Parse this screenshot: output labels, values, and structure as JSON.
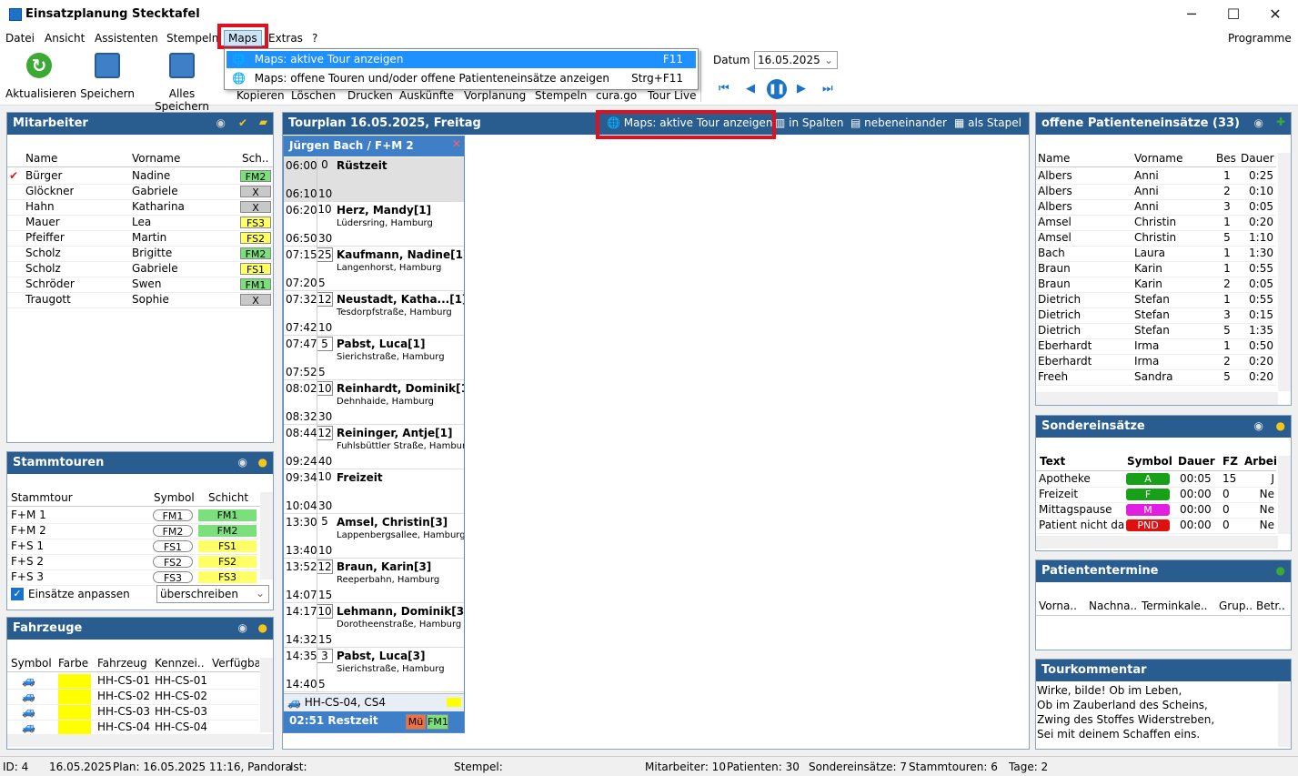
{
  "window": {
    "title": "Einsatzplanung Stecktafel",
    "min": "─",
    "max": "☐",
    "close": "✕"
  },
  "menu": {
    "items": [
      "Datei",
      "Ansicht",
      "Assistenten",
      "Stempeln",
      "Maps",
      "Extras",
      "?"
    ],
    "right": "Programme"
  },
  "toolbar": {
    "refresh": "Aktualisieren",
    "save": "Speichern",
    "save_all": "Alles Speichern",
    "hidden": [
      "Kopieren",
      "Löschen",
      "Drucken",
      "Auskünfte",
      "Vorplanung",
      "Stempeln",
      "cura.go",
      "Tour Live"
    ],
    "date_label": "Datum",
    "date_value": "16.05.2025"
  },
  "dropdown": {
    "items": [
      {
        "label": "Maps: aktive Tour anzeigen",
        "shortcut": "F11"
      },
      {
        "label": "Maps: offene Touren und/oder offene Patienteneinsätze anzeigen",
        "shortcut": "Strg+F11"
      }
    ]
  },
  "mitarbeiter": {
    "title": "Mitarbeiter",
    "cols": [
      "Name",
      "Vorname",
      "Sch.."
    ],
    "rows": [
      [
        "Bürger",
        "Nadine",
        "FM2",
        "green"
      ],
      [
        "Glöckner",
        "Gabriele",
        "X",
        "gray"
      ],
      [
        "Hahn",
        "Katharina",
        "X",
        "gray"
      ],
      [
        "Mauer",
        "Lea",
        "FS3",
        "yellow"
      ],
      [
        "Pfeiffer",
        "Martin",
        "FS2",
        "yellow"
      ],
      [
        "Scholz",
        "Brigitte",
        "FM2",
        "green"
      ],
      [
        "Scholz",
        "Gabriele",
        "FS1",
        "yellow"
      ],
      [
        "Schröder",
        "Swen",
        "FM1",
        "green"
      ],
      [
        "Traugott",
        "Sophie",
        "X",
        "gray"
      ]
    ]
  },
  "stammtouren": {
    "title": "Stammtouren",
    "cols": [
      "Stammtour",
      "Symbol",
      "Schicht"
    ],
    "rows": [
      [
        "F+M 1",
        "FM1",
        "FM1",
        "green"
      ],
      [
        "F+M 2",
        "FM2",
        "FM2",
        "green"
      ],
      [
        "F+S 1",
        "FS1",
        "FS1",
        "yellow"
      ],
      [
        "F+S 2",
        "FS2",
        "FS2",
        "yellow"
      ],
      [
        "F+S 3",
        "FS3",
        "FS3",
        "yellow"
      ]
    ],
    "checkbox": "Einsätze anpassen",
    "select": "überschreiben"
  },
  "fahrzeuge": {
    "title": "Fahrzeuge",
    "cols": [
      "Symbol",
      "Farbe",
      "Fahrzeug",
      "Kennzei..",
      "Verfügba"
    ],
    "rows": [
      [
        "HH-CS-01",
        "HH-CS-01"
      ],
      [
        "HH-CS-02",
        "HH-CS-02"
      ],
      [
        "HH-CS-03",
        "HH-CS-03"
      ],
      [
        "HH-CS-04",
        "HH-CS-04"
      ]
    ]
  },
  "tourplan": {
    "title": "Tourplan 16.05.2025, Freitag",
    "maps_btn": "Maps: aktive Tour anzeigen",
    "spalten": "in Spalten",
    "neben": "nebeneinander",
    "stapel": "als Stapel",
    "tour_header": "Jürgen Bach / F+M 2",
    "entries": [
      {
        "t1": "06:00",
        "n": "0",
        "name": "Rüstzeit",
        "addr": "",
        "t2": "06:10",
        "d2": "10",
        "gray": true
      },
      {
        "t1": "06:20",
        "n": "10",
        "name": "Herz, Mandy[1]",
        "addr": "Lüdersring, Hamburg",
        "t2": "06:50",
        "d2": "30"
      },
      {
        "t1": "07:15",
        "n": "25",
        "name": "Kaufmann, Nadine[1]",
        "addr": "Langenhorst, Hamburg",
        "t2": "07:20",
        "d2": "5",
        "box": true
      },
      {
        "t1": "07:32",
        "n": "12",
        "name": "Neustadt, Katha...[1]",
        "addr": "Tesdorpfstraße, Hamburg",
        "t2": "07:42",
        "d2": "10",
        "box": true
      },
      {
        "t1": "07:47",
        "n": "5",
        "name": "Pabst, Luca[1]",
        "addr": "Sierichstraße, Hamburg",
        "t2": "07:52",
        "d2": "5",
        "box": true
      },
      {
        "t1": "08:02",
        "n": "10",
        "name": "Reinhardt, Dominik[1]",
        "addr": "Dehnhaide, Hamburg",
        "t2": "08:32",
        "d2": "30",
        "box": true
      },
      {
        "t1": "08:44",
        "n": "12",
        "name": "Reininger, Antje[1]",
        "addr": "Fuhlsbüttler Straße, Hamburg",
        "t2": "09:24",
        "d2": "40",
        "box": true
      },
      {
        "t1": "09:34",
        "n": "10",
        "name": "Freizeit",
        "addr": "",
        "t2": "10:04",
        "d2": "30"
      },
      {
        "t1": "13:30",
        "n": "5",
        "name": "Amsel, Christin[3]",
        "addr": "Lappenbergsallee, Hamburg",
        "t2": "13:40",
        "d2": "10"
      },
      {
        "t1": "13:52",
        "n": "12",
        "name": "Braun, Karin[3]",
        "addr": "Reeperbahn, Hamburg",
        "t2": "14:07",
        "d2": "15",
        "box": true
      },
      {
        "t1": "14:17",
        "n": "10",
        "name": "Lehmann, Dominik[3]",
        "addr": "Dorotheenstraße, Hamburg",
        "t2": "14:32",
        "d2": "15",
        "box": true
      },
      {
        "t1": "14:35",
        "n": "3",
        "name": "Pabst, Luca[3]",
        "addr": "Sierichstraße, Hamburg",
        "t2": "14:40",
        "d2": "5",
        "box": true
      }
    ],
    "vehicle": "HH-CS-04, CS4",
    "rest": "02:51 Restzeit",
    "rest_tag1": "Mü",
    "rest_tag2": "FM1"
  },
  "offene": {
    "title": "offene Patienteneinsätze (33)",
    "cols": [
      "Name",
      "Vorname",
      "Bes",
      "Dauer"
    ],
    "rows": [
      [
        "Albers",
        "Anni",
        "1",
        "0:25"
      ],
      [
        "Albers",
        "Anni",
        "2",
        "0:10"
      ],
      [
        "Albers",
        "Anni",
        "3",
        "0:05"
      ],
      [
        "Amsel",
        "Christin",
        "1",
        "0:20"
      ],
      [
        "Amsel",
        "Christin",
        "5",
        "1:10"
      ],
      [
        "Bach",
        "Laura",
        "1",
        "1:30"
      ],
      [
        "Braun",
        "Karin",
        "1",
        "0:55"
      ],
      [
        "Braun",
        "Karin",
        "2",
        "0:05"
      ],
      [
        "Dietrich",
        "Stefan",
        "1",
        "0:55"
      ],
      [
        "Dietrich",
        "Stefan",
        "3",
        "0:15"
      ],
      [
        "Dietrich",
        "Stefan",
        "5",
        "1:35"
      ],
      [
        "Eberhardt",
        "Irma",
        "1",
        "0:50"
      ],
      [
        "Eberhardt",
        "Irma",
        "2",
        "0:20"
      ],
      [
        "Freeh",
        "Sandra",
        "5",
        "0:20"
      ]
    ]
  },
  "sonder": {
    "title": "Sondereinsätze",
    "cols": [
      "Text",
      "Symbol",
      "Dauer",
      "FZ",
      "Arbei"
    ],
    "rows": [
      [
        "Apotheke",
        "A",
        "00:05",
        "15",
        "J",
        "#18a018"
      ],
      [
        "Freizeit",
        "F",
        "00:00",
        "0",
        "Ne",
        "#18a018"
      ],
      [
        "Mittagspause",
        "M",
        "00:00",
        "0",
        "Ne",
        "#e020e0"
      ],
      [
        "Patient nicht da",
        "PND",
        "00:00",
        "0",
        "Ne",
        "#e01010"
      ]
    ]
  },
  "termine": {
    "title": "Patiententermine",
    "cols": [
      "Vorna..",
      "Nachna..",
      "Terminkale..",
      "Grup..",
      "Betr.."
    ]
  },
  "kommentar": {
    "title": "Tourkommentar",
    "lines": [
      "Wirke, bilde! Ob im Leben,",
      "Ob im Zauberland des Scheins,",
      "Zwing des Stoffes Widerstreben,",
      "Sei mit deinem Schaffen eins."
    ]
  },
  "status": {
    "id": "ID: 4",
    "date": "16.05.2025",
    "plan": "Plan: 16.05.2025 11:16, Pandora",
    "ist": "Ist:",
    "stempel": "Stempel:",
    "mitarbeiter": "Mitarbeiter: 10",
    "patienten": "Patienten: 30",
    "sonder": "Sondereinsätze: 7",
    "stamm": "Stammtouren: 6",
    "tage": "Tage: 2"
  }
}
